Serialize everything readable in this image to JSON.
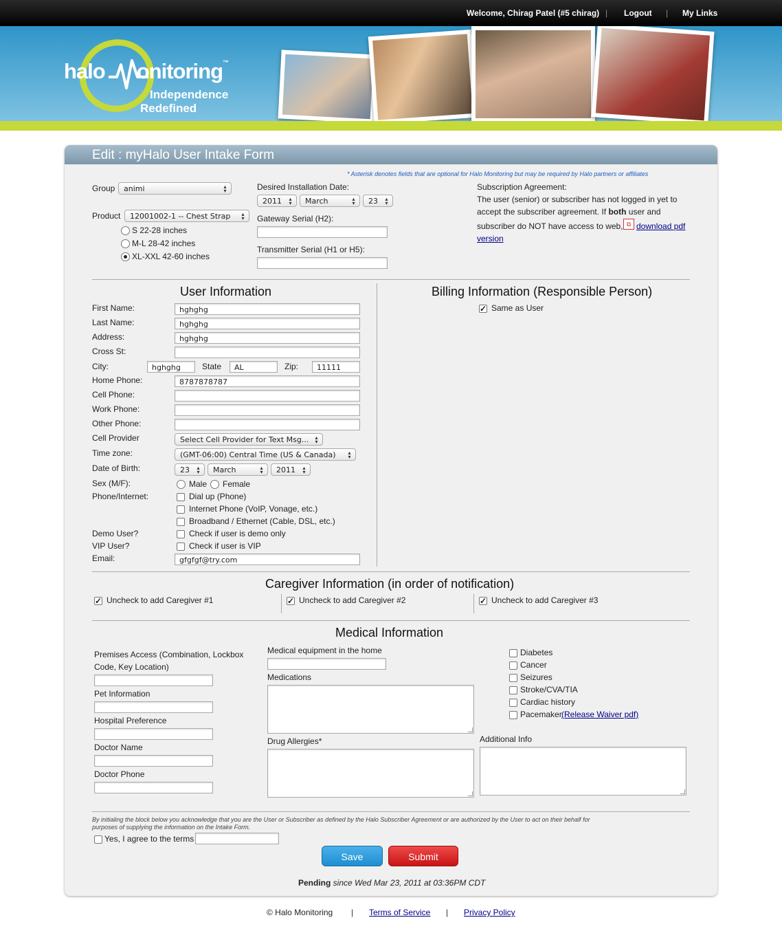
{
  "topbar": {
    "welcome": "Welcome, Chirag Patel (#5 chirag)",
    "logout": "Logout",
    "my_links": "My Links",
    "sep": "|"
  },
  "brand": {
    "logo_left": "halo",
    "logo_right": "onitoring",
    "tm": "™",
    "tagline1": "Independence",
    "tagline2": "Redefined"
  },
  "form_title": "Edit : myHalo User Intake Form",
  "asterisk_note": "* Asterisk denotes fields that are optional for Halo Monitoring but may be required by Halo partners or affiliates",
  "group": {
    "label": "Group",
    "value": "animi"
  },
  "product": {
    "label": "Product",
    "value": "12001002-1 -- Chest Strap",
    "sizes": [
      "S 22-28 inches",
      "M-L 28-42 inches",
      "XL-XXL 42-60 inches"
    ],
    "selected_index": 2
  },
  "install_date": {
    "label": "Desired Installation Date:",
    "year": "2011",
    "month": "March",
    "day": "23"
  },
  "gateway_serial": {
    "label": "Gateway Serial (H2):",
    "value": ""
  },
  "transmitter_serial": {
    "label": "Transmitter Serial (H1 or H5):",
    "value": ""
  },
  "subscription": {
    "title": "Subscription Agreement:",
    "line1": "The user (senior) or subscriber has not logged in yet to",
    "line2a": "accept the subscriber agreement. If ",
    "line2b": "both",
    "line2c": " user and",
    "line3": "subscriber do NOT have access to web,",
    "link1": "download pdf",
    "link2": "version"
  },
  "user_info": {
    "heading": "User Information",
    "first_name": {
      "label": "First Name:",
      "value": "hghghg"
    },
    "last_name": {
      "label": "Last Name:",
      "value": "hghghg"
    },
    "address": {
      "label": "Address:",
      "value": "hghghg"
    },
    "cross_st": {
      "label": "Cross St:",
      "value": ""
    },
    "city": {
      "label": "City:",
      "value": "hghghg"
    },
    "state": {
      "label": "State",
      "value": "AL"
    },
    "zip": {
      "label": "Zip:",
      "value": "11111"
    },
    "home_phone": {
      "label": "Home Phone:",
      "value": "8787878787"
    },
    "cell_phone": {
      "label": "Cell Phone:",
      "value": ""
    },
    "work_phone": {
      "label": "Work Phone:",
      "value": ""
    },
    "other_phone": {
      "label": "Other Phone:",
      "value": ""
    },
    "cell_provider": {
      "label": "Cell Provider",
      "value": "Select Cell Provider for Text Msg..."
    },
    "timezone": {
      "label": "Time zone:",
      "value": "(GMT-06:00) Central Time (US & Canada)"
    },
    "dob": {
      "label": "Date of Birth:",
      "day": "23",
      "month": "March",
      "year": "2011"
    },
    "sex": {
      "label": "Sex (M/F):",
      "male": "Male",
      "female": "Female"
    },
    "phone_internet": {
      "label": "Phone/Internet:",
      "options": [
        "Dial up (Phone)",
        "Internet Phone (VoIP, Vonage, etc.)",
        "Broadband / Ethernet (Cable, DSL, etc.)"
      ]
    },
    "demo": {
      "label": "Demo User?",
      "text": "Check if user is demo only"
    },
    "vip": {
      "label": "VIP User?",
      "text": "Check if user is VIP"
    },
    "email": {
      "label": "Email:",
      "value": "gfgfgf@try.com"
    }
  },
  "billing": {
    "heading": "Billing Information (Responsible Person)",
    "same_as_user": "Same as User"
  },
  "caregiver": {
    "heading": "Caregiver Information (in order of notification)",
    "items": [
      "Uncheck to add Caregiver #1",
      "Uncheck to add Caregiver #2",
      "Uncheck to add Caregiver #3"
    ]
  },
  "medical": {
    "heading": "Medical Information",
    "premises_line1": "Premises Access (Combination, Lockbox",
    "premises_line2": "Code, Key Location)",
    "pet": "Pet Information",
    "hospital": "Hospital Preference",
    "doctor_name": "Doctor Name",
    "doctor_phone": "Doctor Phone",
    "equipment": "Medical equipment in the home",
    "medications": "Medications",
    "allergies": "Drug Allergies*",
    "additional": "Additional Info",
    "conditions": [
      "Diabetes",
      "Cancer",
      "Seizures",
      "Stroke/CVA/TIA",
      "Cardiac history",
      "Pacemaker"
    ],
    "waiver_link": "(Release Waiver pdf)"
  },
  "agreement": {
    "text_line1": "By initialing the block below you acknowledge that you are the User or Subscriber as defined by the Halo Subscriber Agreement or are authorized by the User to act on their behalf for",
    "text_line2": "purposes of supplying the information on the Intake Form.",
    "checkbox": "Yes, I agree to the terms"
  },
  "buttons": {
    "save": "Save",
    "submit": "Submit"
  },
  "status": {
    "bold": "Pending",
    "rest": " since Wed Mar 23, 2011 at 03:36PM CDT"
  },
  "footer": {
    "copyright": "© Halo Monitoring",
    "terms": "Terms of Service",
    "privacy": "Privacy Policy",
    "sep": "|"
  },
  "colors": {
    "save_button": "#1e8ed0",
    "submit_button": "#d81e1e",
    "lime": "#c5d93a",
    "header_blue": "#2f95c8"
  }
}
